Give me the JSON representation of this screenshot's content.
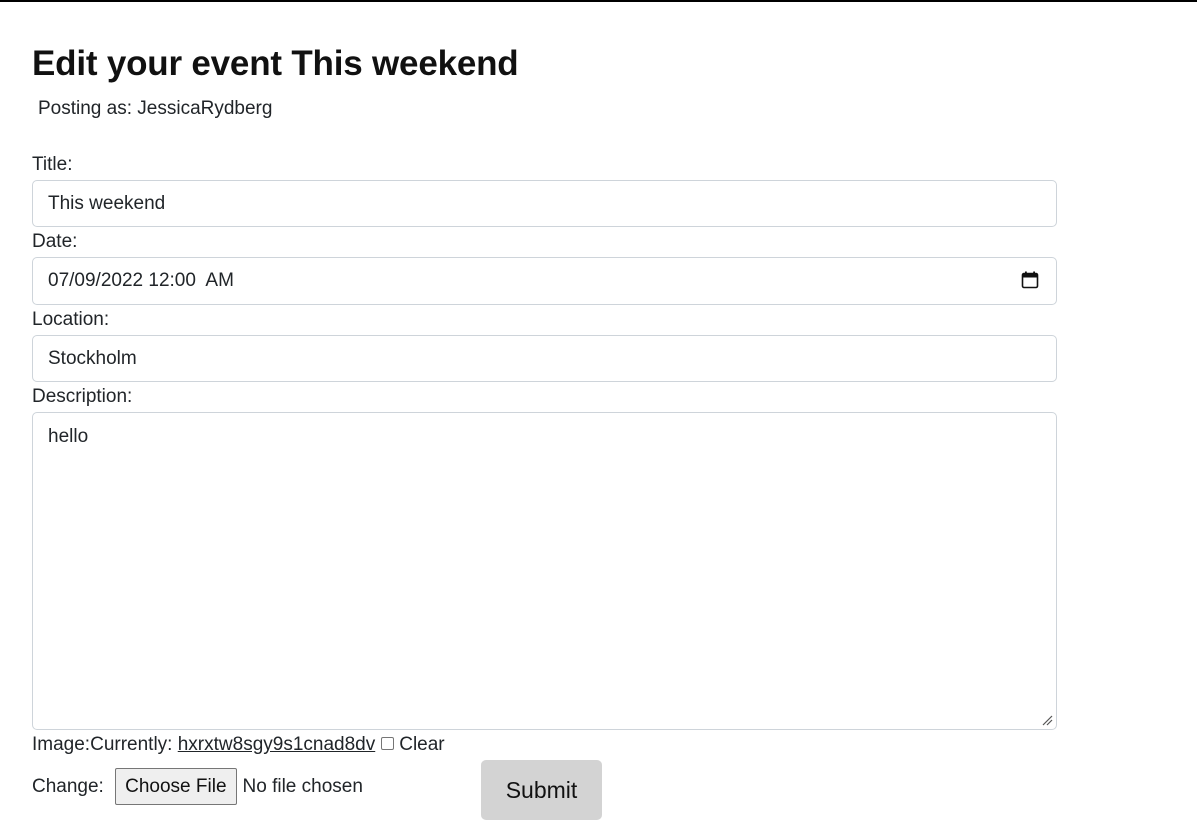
{
  "header": {
    "title": "Edit your event This weekend",
    "posting_as": "Posting as: JessicaRydberg"
  },
  "form": {
    "title_label": "Title:",
    "title_value": "This weekend",
    "date_label": "Date:",
    "date_value": "07/09/2022 12:00  AM",
    "location_label": "Location:",
    "location_value": "Stockholm",
    "description_label": "Description:",
    "description_value": "hello",
    "image_label": "Image:",
    "currently_label": "Currently: ",
    "current_image_link": "hxrxtw8sgy9s1cnad8dv",
    "clear_label": "Clear",
    "clear_checked": false,
    "change_label": "Change: ",
    "choose_file_label": "Choose File",
    "file_status": "No file chosen",
    "submit_label": "Submit"
  },
  "icons": {
    "date_picker": "calendar-icon",
    "textarea_resize": "resize-grip-icon"
  },
  "colors": {
    "input_border": "#ced4da",
    "submit_background": "#d3d3d3",
    "top_rule": "#000000"
  }
}
